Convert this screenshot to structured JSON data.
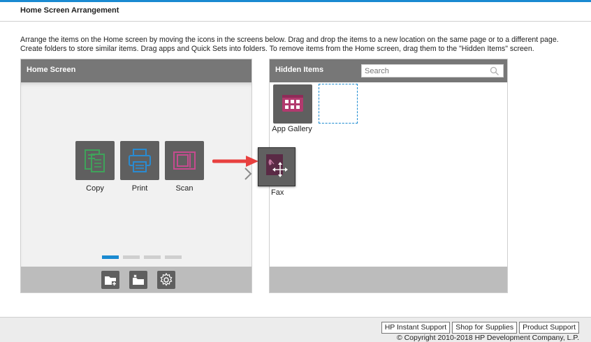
{
  "header": {
    "title": "Home Screen Arrangement"
  },
  "description": "Arrange the items on the Home screen by moving the icons in the screens below. Drag and drop the items to a new location on the same page or to a different page. Create folders to store similar items. Drag apps and Quick Sets into folders. To remove items from the Home screen, drag them to the \"Hidden Items\" screen.",
  "home_panel": {
    "title": "Home Screen",
    "tiles": [
      {
        "label": "Copy",
        "icon": "copy-icon",
        "color": "#3fa35a"
      },
      {
        "label": "Print",
        "icon": "print-icon",
        "color": "#2a8bd1"
      },
      {
        "label": "Scan",
        "icon": "scan-icon",
        "color": "#c64b8f"
      }
    ],
    "pages": 4,
    "active_page": 1,
    "footer_buttons": [
      {
        "icon": "new-folder-icon"
      },
      {
        "icon": "open-folder-icon"
      },
      {
        "icon": "gear-icon"
      }
    ]
  },
  "hidden_panel": {
    "title": "Hidden Items",
    "search_placeholder": "Search",
    "items": [
      {
        "label": "App Gallery",
        "icon": "app-gallery-icon",
        "color": "#b23a6e"
      }
    ]
  },
  "drag_item": {
    "label": "Fax",
    "icon": "fax-icon",
    "color": "#5a2a45"
  },
  "footer": {
    "links": [
      "HP Instant Support",
      "Shop for Supplies",
      "Product Support"
    ],
    "copyright": "© Copyright 2010-2018 HP Development Company, L.P."
  },
  "colors": {
    "accent": "#1a8ad1",
    "arrow": "#e8403f",
    "panel_header": "#777777"
  }
}
